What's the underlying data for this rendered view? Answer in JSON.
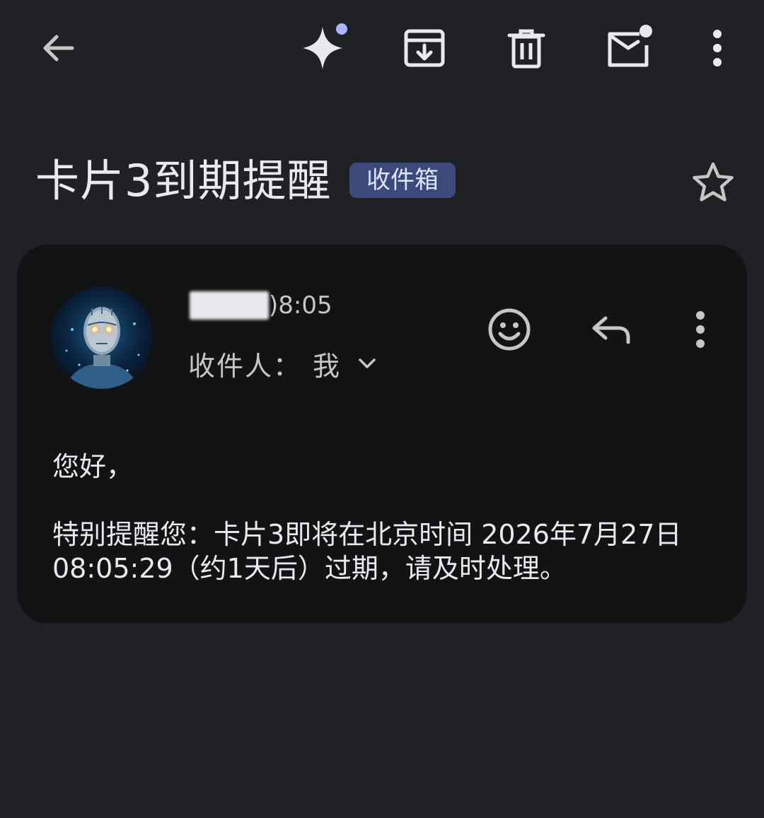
{
  "toolbar": {
    "icons": [
      "back-arrow-icon",
      "gemini-sparkle-icon",
      "archive-icon",
      "delete-icon",
      "mark-unread-icon",
      "more-vert-icon"
    ],
    "accent": "#aab4ff"
  },
  "subject": {
    "title": "卡片3到期提醒",
    "label": "收件箱",
    "label_bg": "#3b4a7a",
    "starred": false
  },
  "message": {
    "sender_name": "█████",
    "time": ")8:05",
    "recipient_label": "收件人：",
    "recipient_value": "我",
    "greeting": "您好，",
    "body": "特别提醒您：卡片3即将在北京时间 2026年7月27日 08:05:29（约1天后）过期，请及时处理。"
  },
  "colors": {
    "background": "#202124",
    "card": "#121315",
    "text": "#e8eaed",
    "secondary_text": "#c4c7c5"
  }
}
